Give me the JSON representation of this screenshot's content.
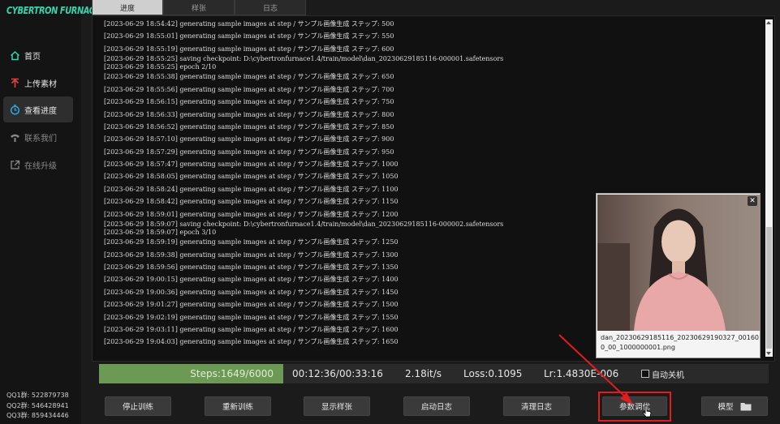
{
  "app": {
    "logo": "CYBERTRON FURNACE"
  },
  "sidebar": {
    "items": [
      {
        "label": "首页",
        "icon": "home-icon"
      },
      {
        "label": "上传素材",
        "icon": "upload-icon"
      },
      {
        "label": "查看进度",
        "icon": "progress-icon"
      },
      {
        "label": "联系我们",
        "icon": "phone-icon"
      },
      {
        "label": "在线升级",
        "icon": "external-link-icon"
      }
    ],
    "qq": [
      "QQ1群: 522879738",
      "QQ2群: 546428941",
      "QQ3群: 859434446"
    ]
  },
  "tabs": [
    "进度",
    "样张",
    "日志"
  ],
  "log": [
    "[2023-06-29 18:54:42] generating sample images at step / サンプル画像生成 ステップ: 500",
    "[2023-06-29 18:55:01] generating sample images at step / サンプル画像生成 ステップ: 550",
    "[2023-06-29 18:55:19] generating sample images at step / サンプル画像生成 ステップ: 600",
    "[2023-06-29 18:55:25] saving checkpoint: D:\\cybertronfurnace1.4/train/model\\dan_20230629185116-000001.safetensors",
    "[2023-06-29 18:55:25] epoch 2/10",
    "[2023-06-29 18:55:38] generating sample images at step / サンプル画像生成 ステップ: 650",
    "[2023-06-29 18:55:56] generating sample images at step / サンプル画像生成 ステップ: 700",
    "[2023-06-29 18:56:15] generating sample images at step / サンプル画像生成 ステップ: 750",
    "[2023-06-29 18:56:33] generating sample images at step / サンプル画像生成 ステップ: 800",
    "[2023-06-29 18:56:52] generating sample images at step / サンプル画像生成 ステップ: 850",
    "[2023-06-29 18:57:10] generating sample images at step / サンプル画像生成 ステップ: 900",
    "[2023-06-29 18:57:29] generating sample images at step / サンプル画像生成 ステップ: 950",
    "[2023-06-29 18:57:47] generating sample images at step / サンプル画像生成 ステップ: 1000",
    "[2023-06-29 18:58:05] generating sample images at step / サンプル画像生成 ステップ: 1050",
    "[2023-06-29 18:58:24] generating sample images at step / サンプル画像生成 ステップ: 1100",
    "[2023-06-29 18:58:42] generating sample images at step / サンプル画像生成 ステップ: 1150",
    "[2023-06-29 18:59:01] generating sample images at step / サンプル画像生成 ステップ: 1200",
    "[2023-06-29 18:59:07] saving checkpoint: D:\\cybertronfurnace1.4/train/model\\dan_20230629185116-000002.safetensors",
    "[2023-06-29 18:59:07] epoch 3/10",
    "[2023-06-29 18:59:19] generating sample images at step / サンプル画像生成 ステップ: 1250",
    "[2023-06-29 18:59:38] generating sample images at step / サンプル画像生成 ステップ: 1300",
    "[2023-06-29 18:59:56] generating sample images at step / サンプル画像生成 ステップ: 1350",
    "[2023-06-29 19:00:15] generating sample images at step / サンプル画像生成 ステップ: 1400",
    "[2023-06-29 19:00:36] generating sample images at step / サンプル画像生成 ステップ: 1450",
    "[2023-06-29 19:01:27] generating sample images at step / サンプル画像生成 ステップ: 1500",
    "[2023-06-29 19:02:19] generating sample images at step / サンプル画像生成 ステップ: 1550",
    "[2023-06-29 19:03:11] generating sample images at step / サンプル画像生成 ステップ: 1600",
    "[2023-06-29 19:04:03] generating sample images at step / サンプル画像生成 ステップ: 1650"
  ],
  "preview": {
    "filename": "dan_20230629185116_20230629190327_001600_00_1000000001.png",
    "close": "✕"
  },
  "stats": {
    "steps": "Steps:1649/6000",
    "progress_fraction": 0.2748,
    "time": "00:12:36/00:33:16",
    "speed": "2.18it/s",
    "loss": "Loss:0.1095",
    "lr": "Lr:1.4830E-006",
    "auto_shutdown": "自动关机"
  },
  "buttons": [
    "停止训练",
    "重新训练",
    "显示样张",
    "启动日志",
    "清理日志",
    "参数调优",
    "模型"
  ],
  "colors": {
    "accent": "#35d3ae",
    "progress": "#6c9a54",
    "highlight": "#e51c1c"
  }
}
